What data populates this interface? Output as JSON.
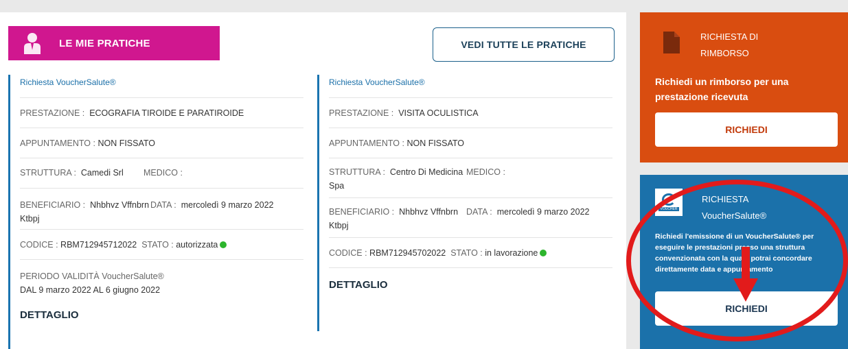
{
  "header": {
    "title": "LE MIE PRATICHE",
    "see_all_label": "VEDI TUTTE LE PRATICHE"
  },
  "cards": [
    {
      "type": "Richiesta VoucherSalute®",
      "prestazione_label": "PRESTAZIONE :",
      "prestazione_value": "ECOGRAFIA TIROIDE E PARATIROIDE",
      "appuntamento_label": "APPUNTAMENTO :",
      "appuntamento_value": "NON FISSATO",
      "struttura_label": "STRUTTURA :",
      "struttura_value": "Camedi Srl",
      "medico_label": "MEDICO :",
      "medico_value": "",
      "beneficiario_label": "BENEFICIARIO :",
      "beneficiario_value": "Nhbhvz Vffnbrn Ktbpj",
      "data_label": "DATA :",
      "data_value": "mercoledì 9 marzo 2022",
      "codice_label": "CODICE :",
      "codice_value": "RBM712945712022",
      "stato_label": "STATO :",
      "stato_value": "autorizzata",
      "periodo_label": "PERIODO VALIDITÀ VoucherSalute®",
      "periodo_value": "DAL  9 marzo 2022 AL  6 giugno 2022",
      "dettaglio_label": "DETTAGLIO"
    },
    {
      "type": "Richiesta VoucherSalute®",
      "prestazione_label": "PRESTAZIONE :",
      "prestazione_value": "VISITA OCULISTICA",
      "appuntamento_label": "APPUNTAMENTO :",
      "appuntamento_value": "NON FISSATO",
      "struttura_label": "STRUTTURA :",
      "struttura_value": "Centro Di Medicina Spa",
      "medico_label": "MEDICO :",
      "medico_value": "",
      "beneficiario_label": "BENEFICIARIO :",
      "beneficiario_value": "Nhbhvz Vffnbrn Ktbpj",
      "data_label": "DATA :",
      "data_value": "mercoledì 9 marzo 2022",
      "codice_label": "CODICE :",
      "codice_value": "RBM712945702022",
      "stato_label": "STATO :",
      "stato_value": "in lavorazione",
      "dettaglio_label": "DETTAGLIO"
    }
  ],
  "rimborso": {
    "title_line1": "RICHIESTA DI",
    "title_line2": "RIMBORSO",
    "description": "Richiedi un rimborso per una prestazione ricevuta",
    "button_label": "RICHIEDI"
  },
  "voucher": {
    "logo_text": "VOUCHER",
    "title_line1": "RICHIESTA",
    "title_line2": "VoucherSalute®",
    "description": "Richiedi l'emissione di un VoucherSalute® per eseguire le prestazioni presso una struttura convenzionata con la quale potrai concordare direttamente data e appuntamento",
    "button_label": "RICHIEDI"
  },
  "colors": {
    "header_magenta": "#d0178f",
    "rimborso_orange": "#d94d10",
    "voucher_blue": "#1b71aa",
    "status_green": "#2db52d",
    "annotation_red": "#e21b1b"
  },
  "icons": [
    "user-icon",
    "document-icon",
    "voucher-logo-icon",
    "annotation-arrow-icon"
  ]
}
